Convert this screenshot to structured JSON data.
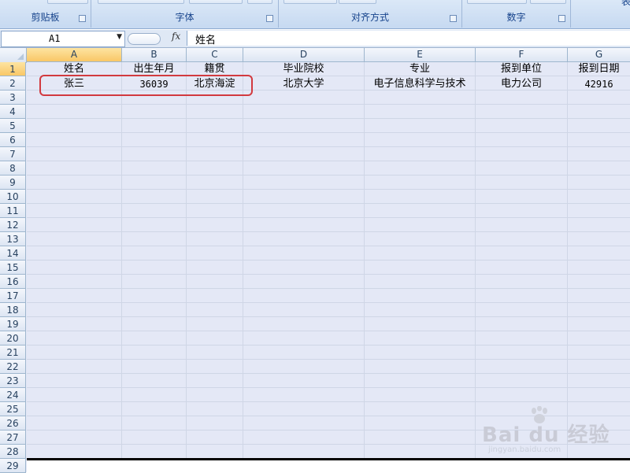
{
  "ribbon": {
    "groups": [
      {
        "label": "剪贴板"
      },
      {
        "label": "字体"
      },
      {
        "label": "对齐方式"
      },
      {
        "label": "数字"
      },
      {
        "label": "表"
      }
    ]
  },
  "formula_bar": {
    "name_box": "A1",
    "fx": "fx",
    "content": "姓名"
  },
  "sheet": {
    "columns": [
      "A",
      "B",
      "C",
      "D",
      "E",
      "F",
      "G"
    ],
    "rows": [
      "1",
      "2",
      "3",
      "4",
      "5",
      "6",
      "7",
      "8",
      "9",
      "10",
      "11",
      "12",
      "13",
      "14",
      "15",
      "16",
      "17",
      "18",
      "19",
      "20",
      "21",
      "22",
      "23",
      "24",
      "25",
      "26",
      "27",
      "28",
      "29"
    ],
    "header_row": [
      "姓名",
      "出生年月",
      "籍贯",
      "毕业院校",
      "专业",
      "报到单位",
      "报到日期"
    ],
    "data_row": [
      "张三",
      "36039",
      "北京海淀",
      "北京大学",
      "电子信息科学与技术",
      "电力公司",
      "42916"
    ]
  },
  "watermark": {
    "logo": "Bai  du 经验",
    "url": "jingyan.baidu.com"
  }
}
